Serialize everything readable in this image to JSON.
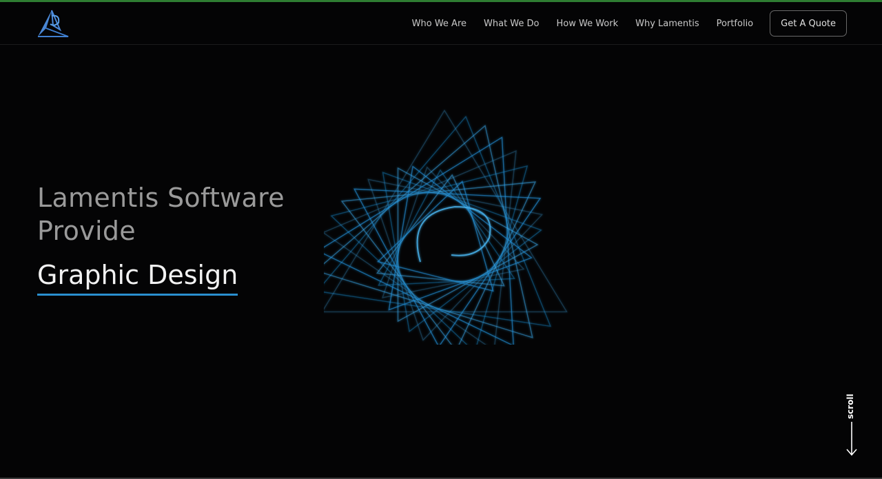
{
  "header": {
    "logo_icon": "lamentis-logo-icon",
    "nav": [
      {
        "label": "Who We Are"
      },
      {
        "label": "What We Do"
      },
      {
        "label": "How We Work"
      },
      {
        "label": "Why Lamentis"
      },
      {
        "label": "Portfolio"
      }
    ],
    "cta_label": "Get A Quote"
  },
  "hero": {
    "headline_line1": "Lamentis Software",
    "headline_line2": "Provide",
    "service": "Graphic Design",
    "art_icon": "spiral-triangle-graphic"
  },
  "scroll": {
    "label": "scroll",
    "icon": "arrow-down-icon"
  },
  "colors": {
    "background": "#040405",
    "accent_blue": "#2a8fd0",
    "top_bar": "#2e7d32",
    "headline_gray": "#9a9a9a"
  }
}
